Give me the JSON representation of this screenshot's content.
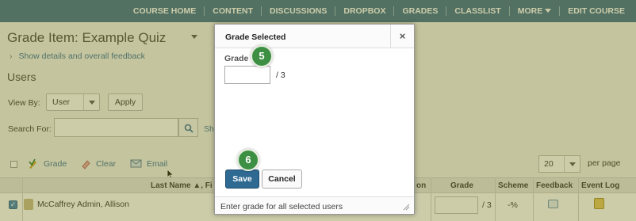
{
  "nav": {
    "items": [
      "COURSE HOME",
      "CONTENT",
      "DISCUSSIONS",
      "DROPBOX",
      "GRADES",
      "CLASSLIST",
      "MORE",
      "EDIT COURSE"
    ]
  },
  "page": {
    "title": "Grade Item: Example Quiz",
    "details_link": "Show details and overall feedback",
    "users_heading": "Users",
    "view_by_label": "View By:",
    "view_by_value": "User",
    "apply_label": "Apply",
    "search_label": "Search For:",
    "search_value": "",
    "show_truncated": "Sh"
  },
  "toolbar": {
    "grade_label": "Grade",
    "clear_label": "Clear",
    "email_label": "Email",
    "per_page_value": "20",
    "per_page_label": "per page"
  },
  "table": {
    "headers": {
      "last_name": "Last Name ▲, Fi",
      "truncated": "on",
      "grade": "Grade",
      "scheme": "Scheme",
      "feedback": "Feedback",
      "event_log": "Event Log"
    },
    "rows": [
      {
        "name": "McCaffrey Admin, Allison",
        "checked": true,
        "grade_value": "",
        "grade_denominator": "/ 3",
        "scheme": "-%"
      }
    ]
  },
  "dialog": {
    "title": "Grade Selected",
    "close_glyph": "×",
    "grade_label": "Grade",
    "grade_value": "",
    "grade_out_of": "/ 3",
    "save_label": "Save",
    "cancel_label": "Cancel",
    "footer_text": "Enter grade for all selected users"
  },
  "callouts": [
    "5",
    "6"
  ],
  "colors": {
    "nav_bg": "#3c6d8e",
    "save_bg": "#2f6a93",
    "badge_bg": "#3d8f44",
    "overlay": "#78781e"
  }
}
